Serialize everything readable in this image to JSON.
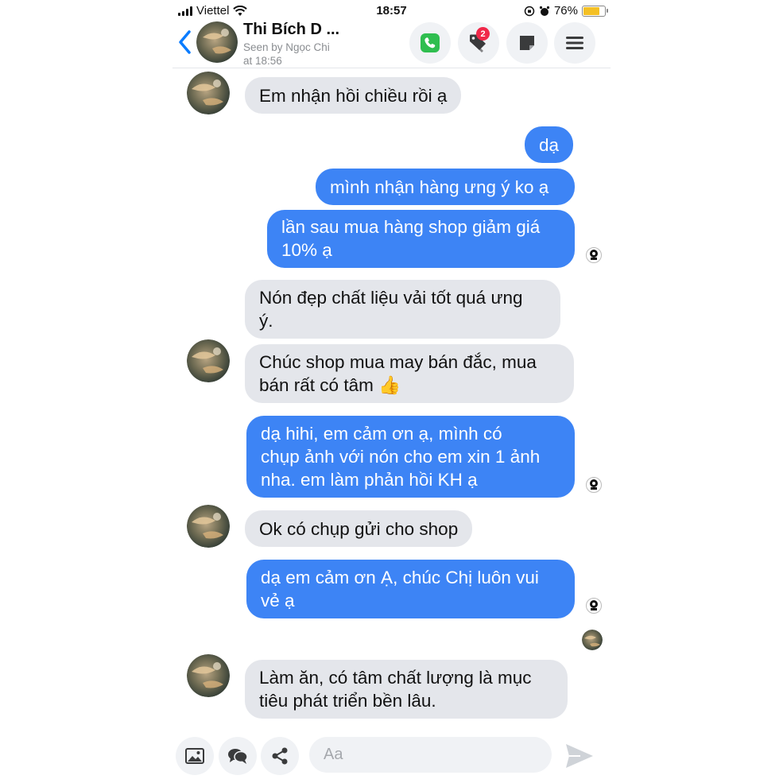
{
  "status_bar": {
    "carrier": "Viettel",
    "time": "18:57",
    "battery": "76%",
    "battery_level": 0.76
  },
  "header": {
    "contact_name": "Thi Bích D ...",
    "seen_line1": "Seen by Ngọc Chi",
    "seen_line2": "at 18:56",
    "tag_badge": "2",
    "icons": [
      "back-chevron-icon",
      "phone-icon",
      "tag-icon",
      "note-icon",
      "menu-icon"
    ]
  },
  "messages": [
    {
      "from": "them",
      "lines": [
        "Em nhận hồi chiều rồi ạ"
      ]
    },
    {
      "from": "me",
      "lines": [
        "dạ"
      ]
    },
    {
      "from": "me",
      "lines": [
        "mình nhận hàng ưng ý ko ạ"
      ]
    },
    {
      "from": "me",
      "lines": [
        "lần sau mua hàng shop giảm giá",
        "10% ạ"
      ]
    },
    {
      "from": "them",
      "lines": [
        "Nón đẹp chất liệu vải tốt quá ưng",
        "ý."
      ]
    },
    {
      "from": "them",
      "lines": [
        "Chúc shop mua may bán đắc, mua",
        "bán rất có tâm 👍"
      ]
    },
    {
      "from": "me",
      "lines": [
        "dạ hihi, em cảm ơn ạ, mình có",
        "chụp ảnh với nón cho em xin 1 ảnh",
        "nha. em làm phản hồi KH ạ"
      ]
    },
    {
      "from": "them",
      "lines": [
        "Ok có chụp gửi cho shop"
      ]
    },
    {
      "from": "me",
      "lines": [
        "dạ em cảm ơn Ạ, chúc Chị luôn vui",
        "vẻ ạ"
      ]
    },
    {
      "from": "them",
      "lines": [
        "Làm ăn, có tâm chất lượng là mục",
        "tiêu phát triển bền lâu."
      ]
    }
  ],
  "composer": {
    "placeholder": "Aa",
    "icons": [
      "image-icon",
      "chat-bubbles-icon",
      "share-icon",
      "send-icon"
    ]
  },
  "colors": {
    "outgoing_bubble": "#3d84f5",
    "incoming_bubble": "#e4e6eb",
    "accent": "#0a7cff",
    "call_green": "#2fbe4f",
    "badge_red": "#f02849"
  }
}
